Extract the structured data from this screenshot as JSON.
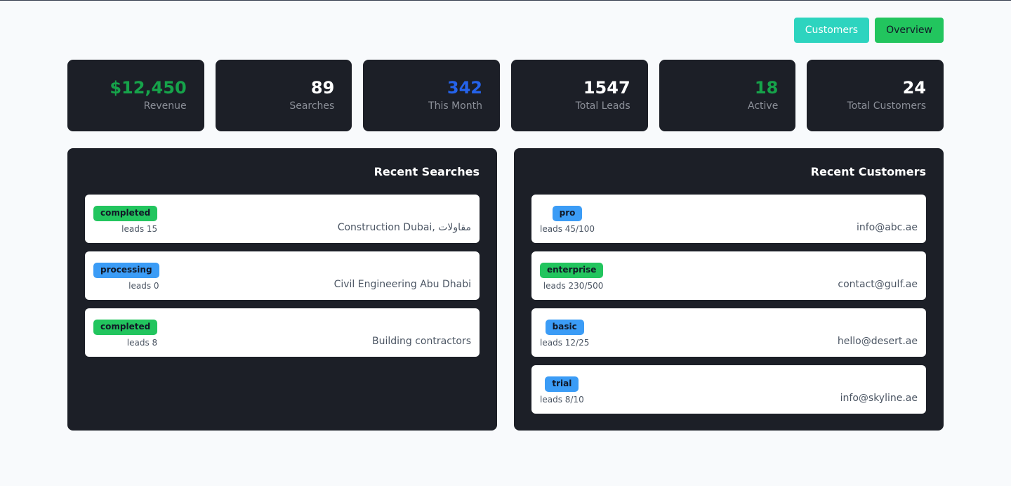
{
  "header": {
    "customers_label": "Customers",
    "overview_label": "Overview"
  },
  "stats": [
    {
      "value": "$12,450",
      "label": "Revenue",
      "color": "#16a34a"
    },
    {
      "value": "89",
      "label": "Searches",
      "color": "#ffffff"
    },
    {
      "value": "342",
      "label": "This Month",
      "color": "#2563eb"
    },
    {
      "value": "1547",
      "label": "Total Leads",
      "color": "#ffffff"
    },
    {
      "value": "18",
      "label": "Active",
      "color": "#16a34a"
    },
    {
      "value": "24",
      "label": "Total Customers",
      "color": "#ffffff"
    }
  ],
  "recent_searches": {
    "title": "Recent Searches",
    "items": [
      {
        "query": "Construction Dubai, مقاولات",
        "status": "completed",
        "status_color": "#22c55e",
        "leads": "leads 15"
      },
      {
        "query": "Civil Engineering Abu Dhabi",
        "status": "processing",
        "status_color": "#3b9cf6",
        "leads": "leads 0"
      },
      {
        "query": "Building contractors",
        "status": "completed",
        "status_color": "#22c55e",
        "leads": "leads 8"
      }
    ]
  },
  "recent_customers": {
    "title": "Recent Customers",
    "items": [
      {
        "email": "info@abc.ae",
        "plan": "pro",
        "plan_color": "#3b9cf6",
        "leads": "leads 45/100"
      },
      {
        "email": "contact@gulf.ae",
        "plan": "enterprise",
        "plan_color": "#22c55e",
        "leads": "leads 230/500"
      },
      {
        "email": "hello@desert.ae",
        "plan": "basic",
        "plan_color": "#3b9cf6",
        "leads": "leads 12/25"
      },
      {
        "email": "info@skyline.ae",
        "plan": "trial",
        "plan_color": "#3b9cf6",
        "leads": "leads 8/10"
      }
    ]
  }
}
